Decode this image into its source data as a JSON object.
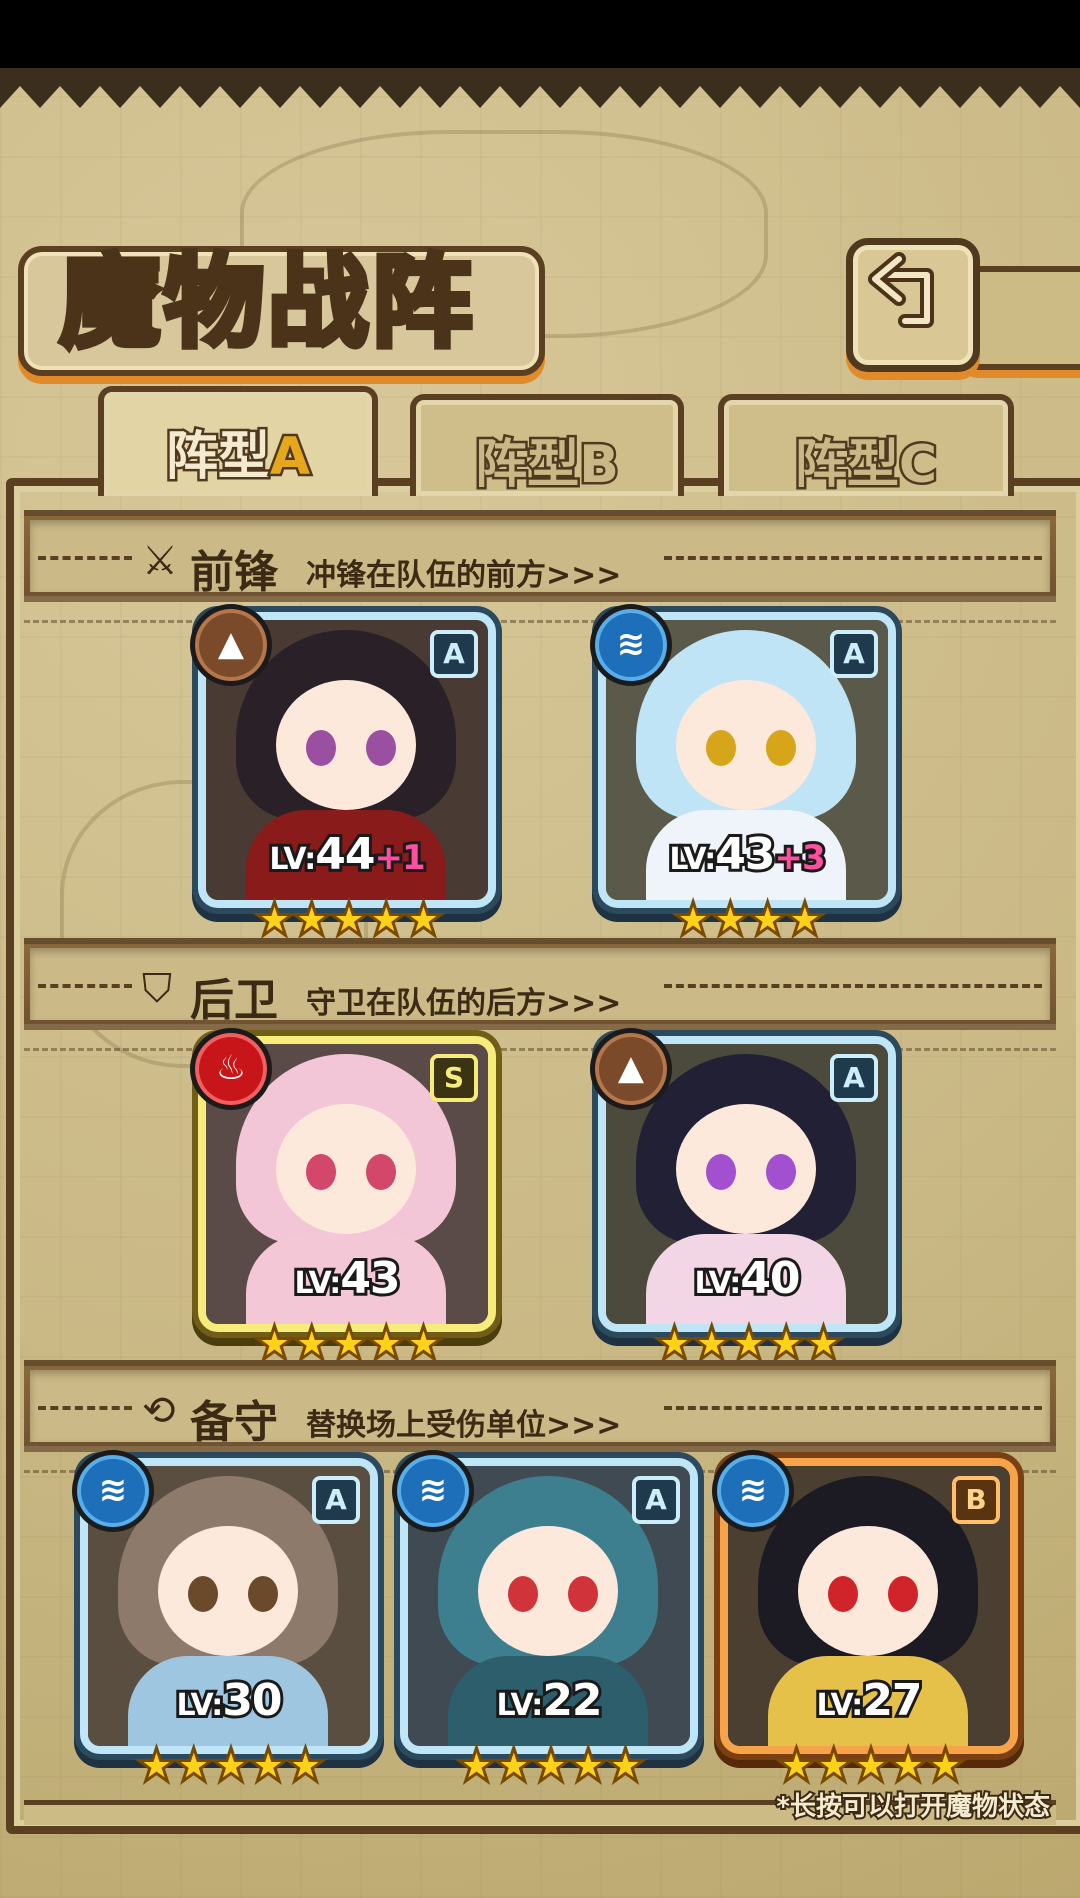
{
  "title": "魔物战阵",
  "tabs": [
    {
      "prefix": "阵型",
      "suffix": "A",
      "active": true
    },
    {
      "prefix": "阵型",
      "suffix": "B",
      "active": false
    },
    {
      "prefix": "阵型",
      "suffix": "C",
      "active": false
    }
  ],
  "sections": {
    "vanguard": {
      "title": "前锋",
      "desc": "冲锋在队伍的前方>>>"
    },
    "rearguard": {
      "title": "后卫",
      "desc": "守卫在队伍的后方>>>"
    },
    "reserve": {
      "title": "备守",
      "desc": "替换场上受伤单位>>>"
    }
  },
  "monsters": {
    "vanguard": [
      {
        "lv_prefix": "LV:",
        "level": "44",
        "bonus": "+1",
        "rank": "A",
        "element": "earth",
        "stars": "★★★★★"
      },
      {
        "lv_prefix": "LV:",
        "level": "43",
        "bonus": "+3",
        "rank": "A",
        "element": "water",
        "stars": "★★★★"
      }
    ],
    "rearguard": [
      {
        "lv_prefix": "LV:",
        "level": "43",
        "rank": "S",
        "element": "fire",
        "stars": "★★★★★"
      },
      {
        "lv_prefix": "LV:",
        "level": "40",
        "rank": "A",
        "element": "earth",
        "stars": "★★★★★"
      }
    ],
    "reserve": [
      {
        "lv_prefix": "LV:",
        "level": "30",
        "rank": "A",
        "element": "water",
        "stars": "★★★★★"
      },
      {
        "lv_prefix": "LV:",
        "level": "22",
        "rank": "A",
        "element": "water",
        "stars": "★★★★★"
      },
      {
        "lv_prefix": "LV:",
        "level": "27",
        "rank": "B",
        "element": "water",
        "stars": "★★★★★"
      }
    ]
  },
  "hint": "*长按可以打开魔物状态",
  "icons": {
    "back": "back-arrow-icon",
    "vanguard": "sword-icon",
    "rearguard": "shield-icon",
    "reserve": "swap-icon",
    "earth": "earth-element-icon",
    "water": "water-element-icon",
    "fire": "fire-element-icon"
  },
  "colors": {
    "accent": "#e08a2a",
    "frame": "#5a4021",
    "parchment": "#c9b884",
    "rank_gold": "#f6ec7a",
    "rank_blue": "#bfe6f6",
    "rank_orange": "#f6a34a"
  }
}
